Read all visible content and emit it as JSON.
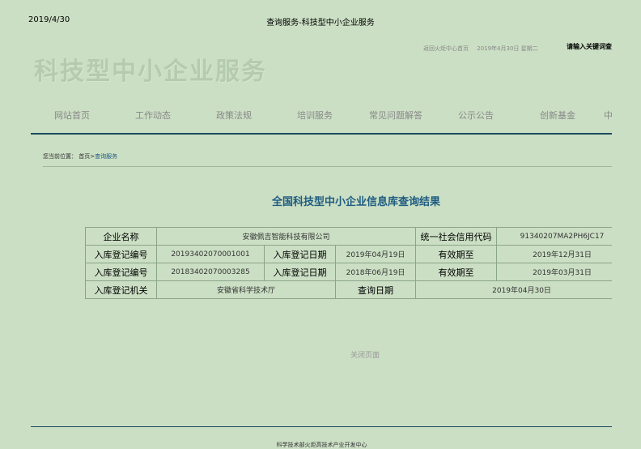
{
  "print_header": {
    "date": "2019/4/30",
    "title": "查询服务-科技型中小企业服务"
  },
  "top_bar": {
    "back_link": "返回火炬中心首页",
    "date": "2019年4月30日 星期二",
    "search_hint": "请输入关键词查询"
  },
  "logo": {
    "text": "科技型中小企业服务"
  },
  "nav": {
    "items": [
      "网站首页",
      "工作动态",
      "政策法规",
      "培训服务",
      "常见问题解答",
      "公示公告",
      "创新基金",
      "中"
    ]
  },
  "breadcrumb": {
    "prefix": "您当前位置：",
    "home": "首页",
    "sep": ">",
    "current": "查询服务"
  },
  "result_title": "全国科技型中小企业信息库查询结果",
  "table": {
    "company_label": "企业名称",
    "company_name": "安徽佩吉智能科技有限公司",
    "credit_label": "统一社会信用代码",
    "credit_code": "91340207MA2PH6JC17",
    "rows": [
      {
        "reg_no_label": "入库登记编号",
        "reg_no": "20193402070001001",
        "reg_date_label": "入库登记日期",
        "reg_date": "2019年04月19日",
        "valid_label": "有效期至",
        "valid": "2019年12月31日"
      },
      {
        "reg_no_label": "入库登记编号",
        "reg_no": "20183402070003285",
        "reg_date_label": "入库登记日期",
        "reg_date": "2018年06月19日",
        "valid_label": "有效期至",
        "valid": "2019年03月31日"
      }
    ],
    "authority_label": "入库登记机关",
    "authority": "安徽省科学技术厅",
    "query_date_label": "查询日期",
    "query_date": "2019年04月30日"
  },
  "close_link": "关闭页面",
  "footer": {
    "text": "科学技术部火炬高技术产业开发中心"
  },
  "colors": {
    "background": "#cbdfc4",
    "title_blue": "#1e5b80",
    "nav_line": "#1c4a60"
  }
}
